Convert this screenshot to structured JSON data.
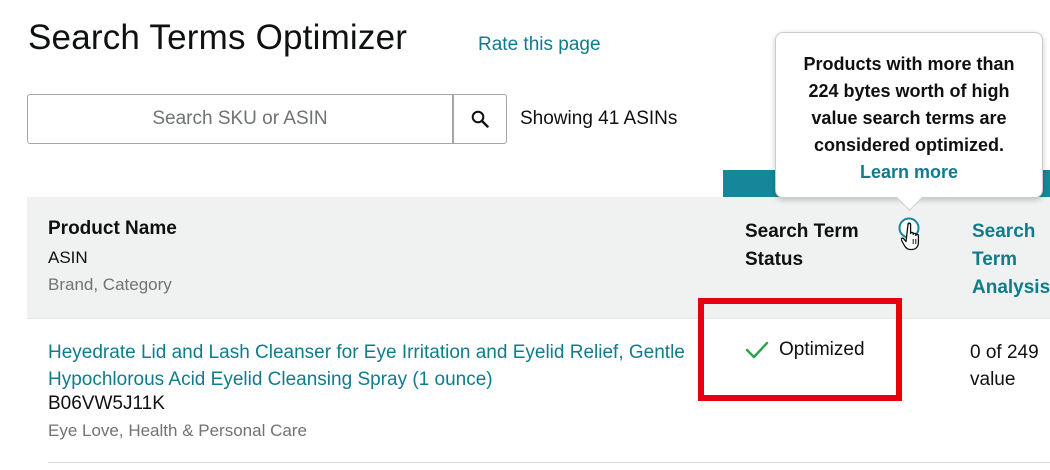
{
  "page": {
    "title": "Search Terms Optimizer",
    "rate_link": "Rate this page"
  },
  "search": {
    "placeholder": "Search SKU or ASIN",
    "button_icon": "search-icon",
    "showing_text": "Showing 41 ASINs"
  },
  "table": {
    "header": {
      "product_name": "Product Name",
      "asin": "ASIN",
      "brand_category": "Brand, Category",
      "status": "Search Term Status",
      "analysis": "Search Term Analysis",
      "info_icon": "info-icon"
    },
    "rows": [
      {
        "product_name": "Heyedrate Lid and Lash Cleanser for Eye Irritation and Eyelid Relief, Gentle Hypochlorous Acid Eyelid Cleansing Spray (1 ounce)",
        "asin": "B06VW5J11K",
        "brand_category": "Eye Love, Health & Personal Care",
        "status": "Optimized",
        "status_icon": "checkmark-icon",
        "analysis": "0 of 249 value"
      }
    ]
  },
  "tooltip": {
    "text": "Products with more than 224 bytes worth of high value search terms are considered optimized.",
    "link": "Learn more"
  },
  "colors": {
    "link": "#0f7c8c",
    "teal_strip": "#15879b",
    "header_bg": "#f0f2f2",
    "highlight_box": "#e8000b",
    "check": "#2ca24d"
  }
}
